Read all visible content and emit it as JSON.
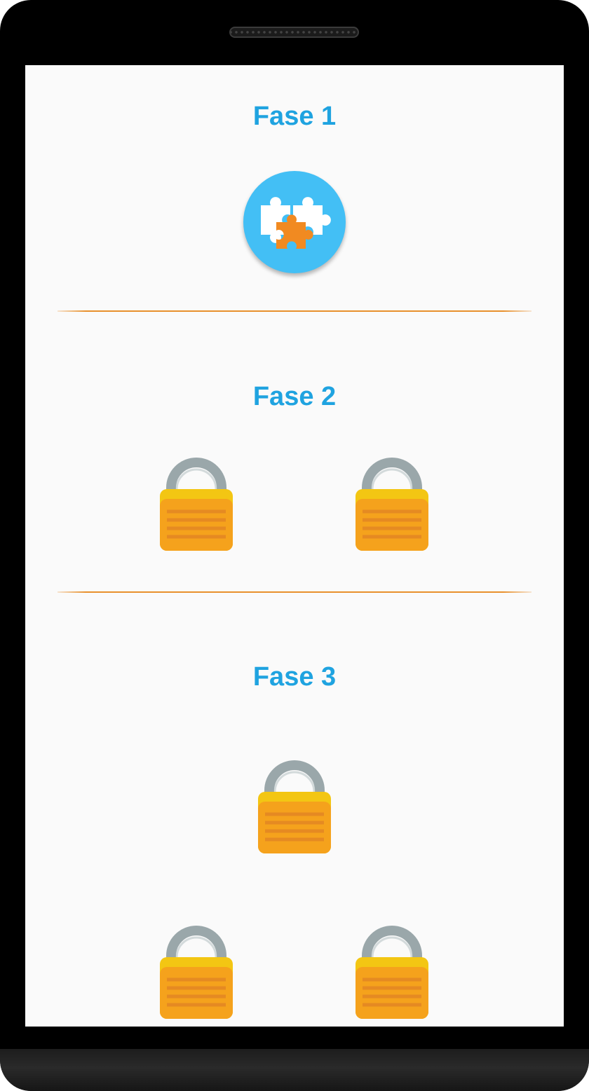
{
  "phases": [
    {
      "title": "Fase 1",
      "levels": [
        {
          "state": "unlocked",
          "icon": "puzzle-icon"
        }
      ]
    },
    {
      "title": "Fase 2",
      "levels": [
        {
          "state": "locked",
          "icon": "lock-icon"
        },
        {
          "state": "locked",
          "icon": "lock-icon"
        }
      ]
    },
    {
      "title": "Fase 3",
      "levels": [
        {
          "state": "locked",
          "icon": "lock-icon"
        },
        {
          "state": "locked",
          "icon": "lock-icon"
        },
        {
          "state": "locked",
          "icon": "lock-icon"
        }
      ]
    }
  ],
  "colors": {
    "title": "#1fa3e0",
    "divider": "#e8902c",
    "level_button": "#43bff5",
    "puzzle_white": "#ffffff",
    "puzzle_orange": "#f18a21",
    "lock_shackle": "#9aa7aa",
    "lock_body": "#f5a21c"
  }
}
